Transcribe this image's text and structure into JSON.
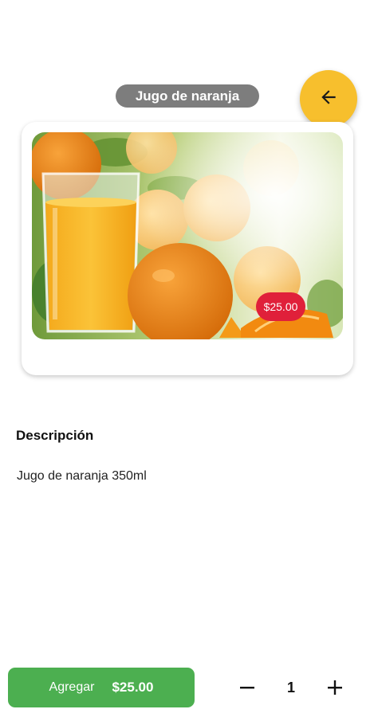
{
  "header": {
    "title": "Jugo de naranja",
    "back_icon": "arrow-left-icon",
    "back_color": "#f7bf2d"
  },
  "product": {
    "image_alt": "orange-juice-photo",
    "price_badge": "$25.00",
    "badge_color": "#e0203a"
  },
  "description": {
    "heading": "Descripción",
    "text": "Jugo de naranja 350ml"
  },
  "footer": {
    "add_label": "Agregar",
    "add_amount": "$25.00",
    "add_color": "#4caf50",
    "quantity": "1",
    "minus_icon": "minus-icon",
    "plus_icon": "plus-icon"
  }
}
